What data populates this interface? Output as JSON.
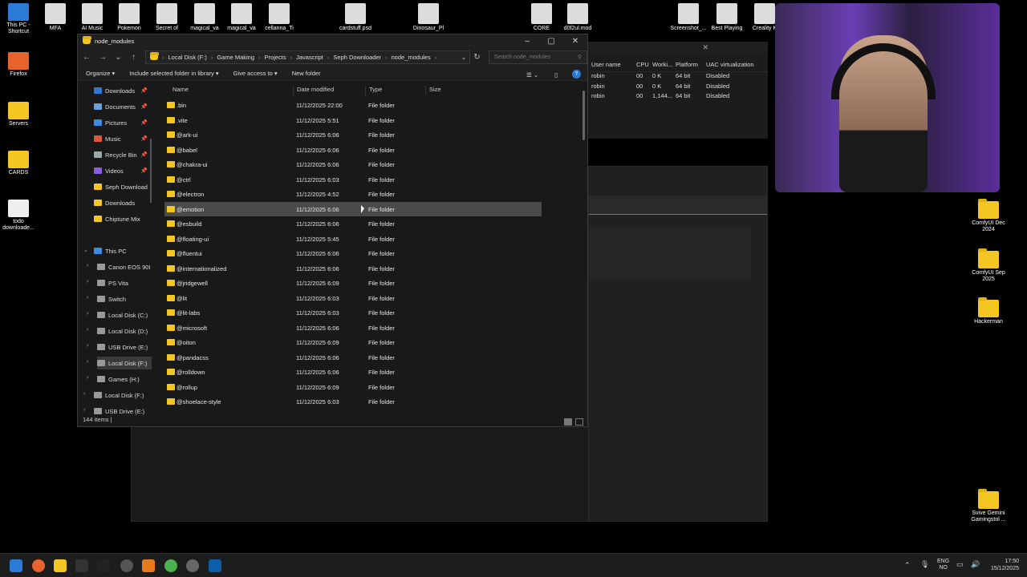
{
  "desktop_icons_left": [
    {
      "label": "This PC - Shortcut",
      "color": "#2b7bd6"
    },
    {
      "label": "Firefox",
      "color": "#e8632b"
    },
    {
      "label": "Servers",
      "color": "#f3c623"
    },
    {
      "label": "CARDS",
      "color": "#f3c623"
    },
    {
      "label": "todo downloade...",
      "color": "#eeeeee"
    }
  ],
  "desktop_icons_top": [
    "MFA",
    "AI Music",
    "Pokemon",
    "Secret of",
    "magical_va",
    "magical_va",
    "cellanna_Ti",
    "cardstuff.psd",
    "Dinosaur_Pl",
    "CORE",
    "d0f2ul.mod",
    "Screenshot_...",
    "Best Playing",
    "Creality K"
  ],
  "desktop_icons_right": [
    "ComfyUI Dec 2024",
    "ComfyUI Sep 2025",
    "Hackerman",
    "Svive Gemini Gamingstol ..."
  ],
  "explorer": {
    "title": "node_modules",
    "breadcrumb": [
      "Local Disk (F:)",
      "Game Making",
      "Projects",
      "Javascript",
      "Seph Downloader",
      "node_modules"
    ],
    "search_placeholder": "Search node_modules",
    "commands": [
      "Organize",
      "Include selected folder in library",
      "Give access to",
      "New folder"
    ],
    "sidebar_quick": [
      "Downloads",
      "Documents",
      "Pictures",
      "Music",
      "Recycle Bin",
      "Videos",
      "Seph Download",
      "Downloads",
      "Chiptune Mix"
    ],
    "sidebar_pc": [
      "This PC",
      "Canon EOS 90I",
      "PS Vita",
      "Switch",
      "Local Disk (C:)",
      "Local Disk (D:)",
      "USB Drive (E:)",
      "Local Disk (F:)",
      "Games (H:)",
      "Local Disk (F:)",
      "USB Drive (E:)"
    ],
    "columns": [
      "Name",
      "Date modified",
      "Type",
      "Size"
    ],
    "rows": [
      {
        "name": ".bin",
        "date": "11/12/2025 22:00",
        "type": "File folder"
      },
      {
        "name": ".vite",
        "date": "11/12/2025 5:51",
        "type": "File folder"
      },
      {
        "name": "@ark-ui",
        "date": "11/12/2025 6:06",
        "type": "File folder"
      },
      {
        "name": "@babel",
        "date": "11/12/2025 6:06",
        "type": "File folder"
      },
      {
        "name": "@chakra-ui",
        "date": "11/12/2025 6:06",
        "type": "File folder"
      },
      {
        "name": "@ctrl",
        "date": "11/12/2025 6:03",
        "type": "File folder"
      },
      {
        "name": "@electron",
        "date": "11/12/2025 4:52",
        "type": "File folder"
      },
      {
        "name": "@emotion",
        "date": "11/12/2025 6:06",
        "type": "File folder"
      },
      {
        "name": "@esbuild",
        "date": "11/12/2025 6:06",
        "type": "File folder"
      },
      {
        "name": "@floating-ui",
        "date": "11/12/2025 5:45",
        "type": "File folder"
      },
      {
        "name": "@fluentui",
        "date": "11/12/2025 6:06",
        "type": "File folder"
      },
      {
        "name": "@internationalized",
        "date": "11/12/2025 6:06",
        "type": "File folder"
      },
      {
        "name": "@jridgewell",
        "date": "11/12/2025 6:09",
        "type": "File folder"
      },
      {
        "name": "@lit",
        "date": "11/12/2025 6:03",
        "type": "File folder"
      },
      {
        "name": "@lit-labs",
        "date": "11/12/2025 6:03",
        "type": "File folder"
      },
      {
        "name": "@microsoft",
        "date": "11/12/2025 6:06",
        "type": "File folder"
      },
      {
        "name": "@oiton",
        "date": "11/12/2025 6:09",
        "type": "File folder"
      },
      {
        "name": "@pandacss",
        "date": "11/12/2025 6:06",
        "type": "File folder"
      },
      {
        "name": "@rolldown",
        "date": "11/12/2025 6:06",
        "type": "File folder"
      },
      {
        "name": "@rollup",
        "date": "11/12/2025 6:09",
        "type": "File folder"
      },
      {
        "name": "@shoelace-style",
        "date": "11/12/2025 6:03",
        "type": "File folder"
      }
    ],
    "selected_index": 7,
    "status": "144 items"
  },
  "taskmgr": {
    "columns": [
      "User name",
      "CPU",
      "Worki...",
      "Platform",
      "UAC virtualization"
    ],
    "rows": [
      [
        "robin",
        "00",
        "0 K",
        "64 bit",
        "Disabled"
      ],
      [
        "robin",
        "00",
        "0 K",
        "64 bit",
        "Disabled"
      ],
      [
        "robin",
        "00",
        "1,144...",
        "64 bit",
        "Disabled"
      ]
    ]
  },
  "taskbar": {
    "lang": "ENG",
    "region": "NO",
    "time": "17:50",
    "date": "15/12/2025"
  }
}
